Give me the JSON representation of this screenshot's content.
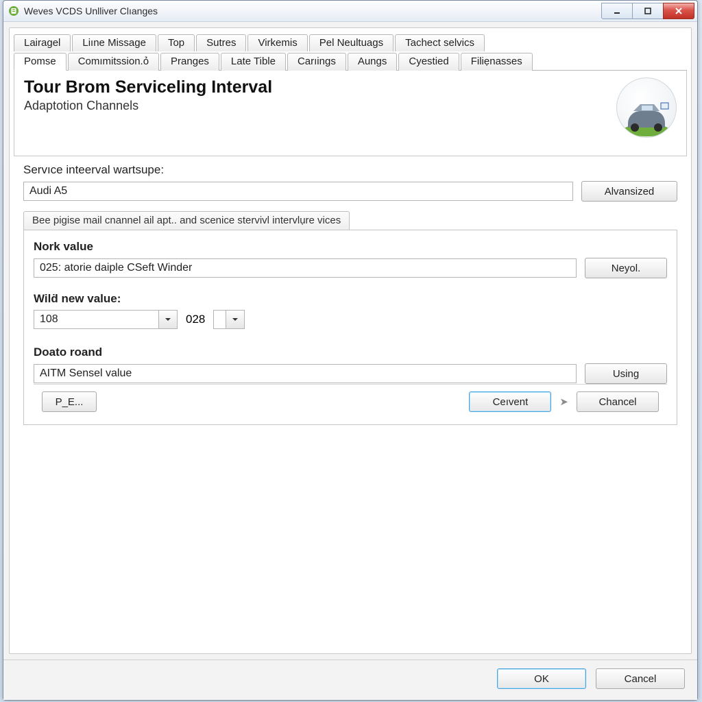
{
  "window": {
    "title": "Weves VCDS Unlliver Clıanges"
  },
  "tabs_row1": [
    {
      "label": "Lairagel"
    },
    {
      "label": "Liıne  Missage"
    },
    {
      "label": "Top"
    },
    {
      "label": "Sutres"
    },
    {
      "label": "Virkemis"
    },
    {
      "label": "Pel Neultuags"
    },
    {
      "label": "Tachect selvics"
    }
  ],
  "tabs_row2": [
    {
      "label": "Pomse",
      "active": true
    },
    {
      "label": "Comımitssion.ỏ"
    },
    {
      "label": "Pranges"
    },
    {
      "label": "Late Tible"
    },
    {
      "label": "Carıings"
    },
    {
      "label": "Aungs"
    },
    {
      "label": "Cyestied"
    },
    {
      "label": "Filiẹnasses"
    }
  ],
  "header": {
    "title": "Tour Brom Serviceling Interval",
    "subtitle": "Adaptotion Channels"
  },
  "service_interval": {
    "label": "Servıce inteerval wartsupe:",
    "value": "Audi A5",
    "advanced_btn": "Alvansized"
  },
  "hint_tab": "Bee pigise mail cnannel ail apt.. and scenice stervivl intervlụre vices",
  "nork": {
    "label": "Nork value",
    "value": "025: atorie daiple CSeft Winder",
    "btn": "Neyol."
  },
  "new_value": {
    "label": "Wilḋ new value:",
    "combo1": "108",
    "combo2": "028"
  },
  "doato": {
    "label": "Doato roand",
    "value": "AITM Sensel value",
    "btn": "Using"
  },
  "inner_footer": {
    "pe": "P_E...",
    "cevent": "Ceıvent",
    "chancel": "Chancel"
  },
  "outer_footer": {
    "ok": "OK",
    "cancel": "Cancel"
  }
}
